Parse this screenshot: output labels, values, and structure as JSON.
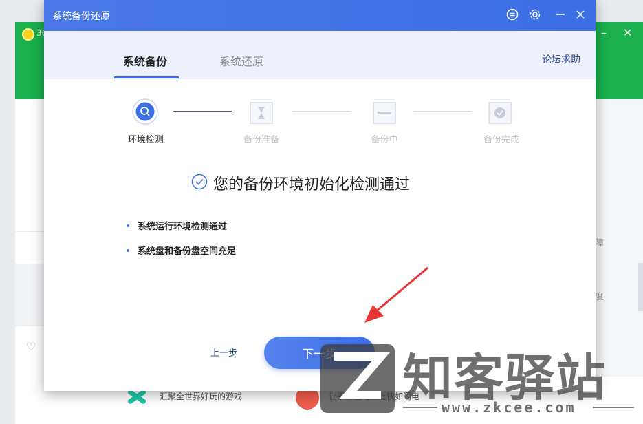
{
  "background_app": {
    "logo_text": "36",
    "right_texts": [
      "障",
      "度"
    ],
    "bottom_items": [
      {
        "text": "汇聚全世界好玩的游戏"
      },
      {
        "text": "让手游在电脑上快如闪电"
      }
    ]
  },
  "dialog": {
    "title": "系统备份还原",
    "tabs": [
      {
        "label": "系统备份",
        "active": true
      },
      {
        "label": "系统还原",
        "active": false
      }
    ],
    "forum_link": "论坛求助",
    "steps": [
      {
        "label": "环境检测",
        "active": true
      },
      {
        "label": "备份准备",
        "active": false
      },
      {
        "label": "备份中",
        "active": false
      },
      {
        "label": "备份完成",
        "active": false
      }
    ],
    "result_title": "您的备份环境初始化检测通过",
    "checks": [
      "系统运行环境检测通过",
      "系统盘和备份盘空间充足"
    ],
    "prev_button": "上一步",
    "next_button": "下一步"
  },
  "watermark": {
    "text": "知客驿站",
    "url": "www.zkcee.com"
  },
  "colors": {
    "accent": "#3c6ee6",
    "bg_app_green": "#19b04d",
    "annotation_red": "#e83434"
  }
}
